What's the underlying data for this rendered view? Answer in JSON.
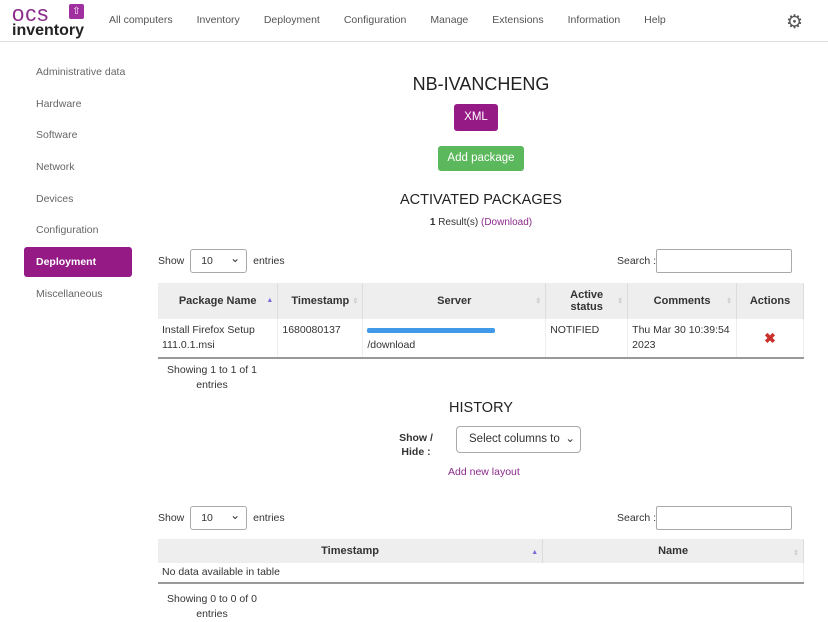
{
  "nav": {
    "logo_top": "ocs",
    "logo_bottom": "inventory",
    "items": [
      "All computers",
      "Inventory",
      "Deployment",
      "Configuration",
      "Manage",
      "Extensions",
      "Information",
      "Help"
    ],
    "settings_icon": "gear-icon"
  },
  "sidebar": {
    "items": [
      "Administrative data",
      "Hardware",
      "Software",
      "Network",
      "Devices",
      "Configuration",
      "Deployment",
      "Miscellaneous"
    ],
    "active": "Deployment"
  },
  "main": {
    "computer_name": "NB-IVANCHENG",
    "xml_label": "XML",
    "add_package_label": "Add package",
    "activated": {
      "title": "ACTIVATED PACKAGES",
      "result_count": "1",
      "result_text": "Result(s)",
      "download": "(Download)",
      "show_label": "Show",
      "entries_label": "entries",
      "page_size": "10",
      "search_label": "Search :",
      "search_value": "",
      "columns": [
        "Package Name",
        "Timestamp",
        "Server",
        "Active status",
        "Comments",
        "Actions"
      ],
      "rows": [
        {
          "package_name": "Install Firefox Setup 111.0.1.msi",
          "timestamp": "1680080137",
          "server_suffix": "/download",
          "active_status": "NOTIFIED",
          "comments": "Thu Mar 30 10:39:54 2023",
          "action_icon": "delete-x-icon"
        }
      ],
      "info": "Showing 1 to 1 of 1 entries"
    },
    "history": {
      "title": "HISTORY",
      "show_hide_label": "Show / Hide :",
      "select_columns": "Select columns to",
      "add_layout": "Add new layout",
      "show_label": "Show",
      "entries_label": "entries",
      "page_size": "10",
      "search_label": "Search :",
      "search_value": "",
      "columns": [
        "Timestamp",
        "Name"
      ],
      "empty": "No data available in table",
      "info": "Showing 0 to 0 of 0 entries"
    }
  },
  "colors": {
    "brand": "#951a86",
    "success": "#5cb85c",
    "delete": "#c9302c"
  }
}
